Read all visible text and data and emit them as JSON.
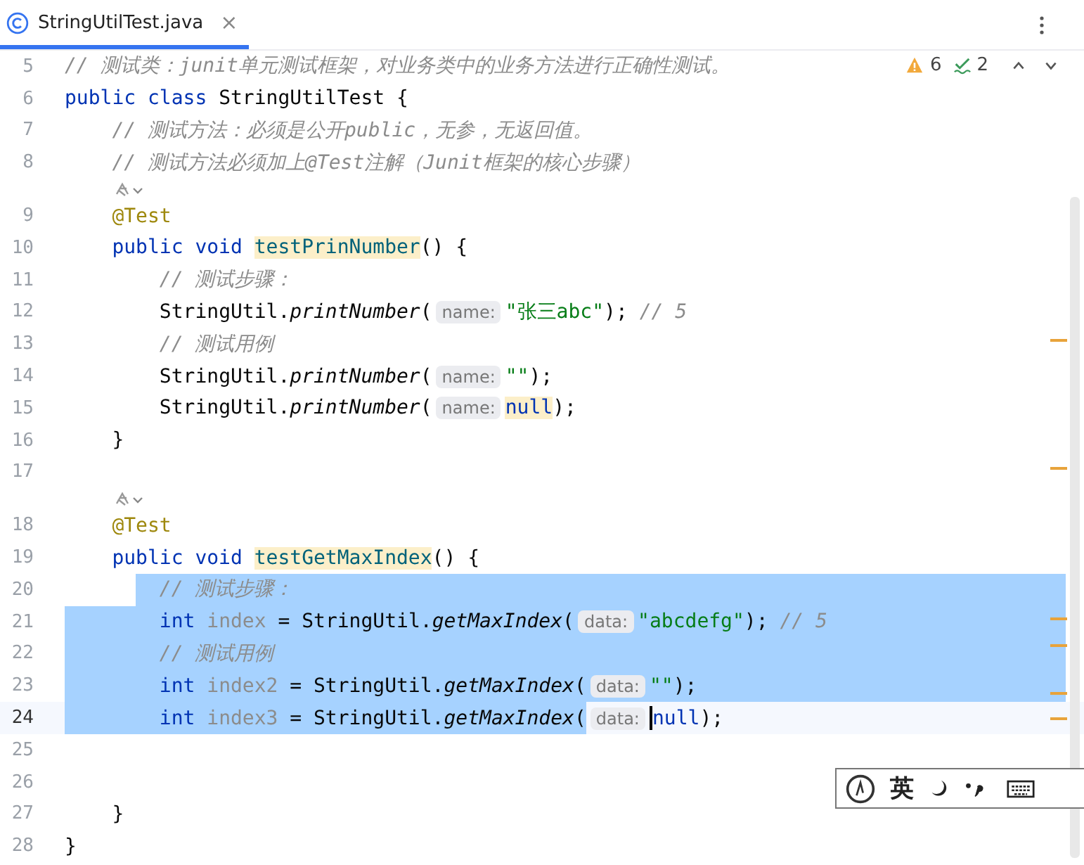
{
  "tab": {
    "title": "StringUtilTest.java",
    "selected": true,
    "close": "×"
  },
  "inspections": {
    "warnings": "6",
    "weak_warnings": "2"
  },
  "rows": [
    {
      "kind": "code",
      "number": "5",
      "selected": false,
      "current": false,
      "tokens": [
        {
          "kind": "comment",
          "text": "// 测试类：junit单元测试框架，对业务类中的业务方法进行正确性测试。"
        }
      ]
    },
    {
      "kind": "code",
      "number": "6",
      "selected": false,
      "current": false,
      "tokens": [
        {
          "kind": "keyword",
          "text": "public class "
        },
        {
          "kind": "plain",
          "text": "StringUtilTest {"
        }
      ],
      "children": [
        {
          "kind": "code",
          "number": "7",
          "selected": false,
          "current": false,
          "tokens": [
            {
              "kind": "comment",
              "text": "// 测试方法：必须是公开public，无参，无返回值。"
            }
          ]
        },
        {
          "kind": "code",
          "number": "8",
          "selected": false,
          "current": false,
          "tokens": [
            {
              "kind": "comment",
              "text": "// 测试方法必须加上@Test注解（Junit框架的核心步骤）"
            }
          ]
        },
        {
          "kind": "inlay"
        },
        {
          "kind": "code",
          "number": "9",
          "selected": false,
          "current": false,
          "tokens": [
            {
              "kind": "annotation",
              "text": "@Test"
            }
          ]
        },
        {
          "kind": "code",
          "number": "10",
          "selected": false,
          "current": false,
          "tokens": [
            {
              "kind": "keyword",
              "text": "public void "
            },
            {
              "kind": "decl",
              "text": "testPrinNumber"
            },
            {
              "kind": "plain",
              "text": "() {"
            }
          ],
          "children": [
            {
              "kind": "code",
              "number": "11",
              "selected": false,
              "current": false,
              "tokens": [
                {
                  "kind": "comment",
                  "text": "// 测试步骤："
                }
              ]
            },
            {
              "kind": "code",
              "number": "12",
              "selected": false,
              "current": false,
              "tokens": [
                {
                  "kind": "plain",
                  "text": "StringUtil."
                },
                {
                  "kind": "call",
                  "text": "printNumber"
                },
                {
                  "kind": "plain",
                  "text": "("
                },
                {
                  "kind": "hint",
                  "text": "name:"
                },
                {
                  "kind": "string",
                  "text": "\"张三abc\""
                },
                {
                  "kind": "plain",
                  "text": "); "
                },
                {
                  "kind": "comment",
                  "text": "// 5"
                }
              ]
            },
            {
              "kind": "code",
              "number": "13",
              "selected": false,
              "current": false,
              "tokens": [
                {
                  "kind": "comment",
                  "text": "// 测试用例"
                }
              ]
            },
            {
              "kind": "code",
              "number": "14",
              "selected": false,
              "current": false,
              "tokens": [
                {
                  "kind": "plain",
                  "text": "StringUtil."
                },
                {
                  "kind": "call",
                  "text": "printNumber"
                },
                {
                  "kind": "plain",
                  "text": "("
                },
                {
                  "kind": "hint",
                  "text": "name:"
                },
                {
                  "kind": "string",
                  "text": "\"\""
                },
                {
                  "kind": "plain",
                  "text": ");"
                }
              ]
            },
            {
              "kind": "code",
              "number": "15",
              "selected": false,
              "current": false,
              "tokens": [
                {
                  "kind": "plain",
                  "text": "StringUtil."
                },
                {
                  "kind": "call",
                  "text": "printNumber"
                },
                {
                  "kind": "plain",
                  "text": "("
                },
                {
                  "kind": "hint",
                  "text": "name:"
                },
                {
                  "kind": "keyword_hl",
                  "text": "null"
                },
                {
                  "kind": "plain",
                  "text": ");"
                }
              ]
            }
          ]
        },
        {
          "kind": "code",
          "number": "16",
          "selected": false,
          "current": false,
          "tokens": [
            {
              "kind": "plain",
              "text": "}"
            }
          ]
        },
        {
          "kind": "code",
          "number": "17",
          "selected": false,
          "current": false
        },
        {
          "kind": "inlay"
        },
        {
          "kind": "code",
          "number": "18",
          "selected": false,
          "current": false,
          "tokens": [
            {
              "kind": "annotation",
              "text": "@Test"
            }
          ]
        },
        {
          "kind": "code",
          "number": "19",
          "selected": false,
          "current": false,
          "tokens": [
            {
              "kind": "keyword",
              "text": "public void "
            },
            {
              "kind": "decl",
              "text": "testGetMaxIndex"
            },
            {
              "kind": "plain",
              "text": "() {"
            }
          ],
          "children": [
            {
              "kind": "code",
              "number": "20",
              "selected": true,
              "current": false,
              "tokens": [
                {
                  "kind": "comment",
                  "text": "// 测试步骤："
                }
              ]
            },
            {
              "kind": "code",
              "number": "21",
              "selected": true,
              "current": false,
              "tokens": [
                {
                  "kind": "keyword",
                  "text": "int "
                },
                {
                  "kind": "unused",
                  "text": "index"
                },
                {
                  "kind": "plain",
                  "text": " = StringUtil."
                },
                {
                  "kind": "call",
                  "text": "getMaxIndex"
                },
                {
                  "kind": "plain",
                  "text": "("
                },
                {
                  "kind": "hint",
                  "text": "data:"
                },
                {
                  "kind": "string",
                  "text": "\"abcdefg\""
                },
                {
                  "kind": "plain",
                  "text": "); "
                },
                {
                  "kind": "comment",
                  "text": "// 5"
                }
              ]
            },
            {
              "kind": "code",
              "number": "22",
              "selected": true,
              "current": false,
              "tokens": [
                {
                  "kind": "comment",
                  "text": "// 测试用例"
                }
              ]
            },
            {
              "kind": "code",
              "number": "23",
              "selected": true,
              "current": false,
              "tokens": [
                {
                  "kind": "keyword",
                  "text": "int "
                },
                {
                  "kind": "unused",
                  "text": "index2"
                },
                {
                  "kind": "plain",
                  "text": " = StringUtil."
                },
                {
                  "kind": "call",
                  "text": "getMaxIndex"
                },
                {
                  "kind": "plain",
                  "text": "("
                },
                {
                  "kind": "hint",
                  "text": "data:"
                },
                {
                  "kind": "string",
                  "text": "\"\""
                },
                {
                  "kind": "plain",
                  "text": ");"
                }
              ]
            },
            {
              "kind": "code",
              "number": "24",
              "selected": true,
              "current": true,
              "tokens": [
                {
                  "kind": "keyword",
                  "text": "int "
                },
                {
                  "kind": "unused",
                  "text": "index3"
                },
                {
                  "kind": "plain",
                  "text": " = StringUtil."
                },
                {
                  "kind": "call",
                  "text": "getMaxIndex"
                },
                {
                  "kind": "plain",
                  "text": "("
                },
                {
                  "kind": "hint",
                  "text": "data:"
                },
                {
                  "kind": "caret"
                },
                {
                  "kind": "keyword",
                  "text": "null"
                },
                {
                  "kind": "plain",
                  "text": ");"
                }
              ]
            },
            {
              "kind": "code",
              "number": "25",
              "selected": false,
              "current": false
            },
            {
              "kind": "code",
              "number": "26",
              "selected": false,
              "current": false
            }
          ]
        },
        {
          "kind": "code",
          "number": "27",
          "selected": false,
          "current": false,
          "tokens": [
            {
              "kind": "plain",
              "text": "}"
            }
          ]
        }
      ]
    },
    {
      "kind": "code",
      "number": "28",
      "selected": false,
      "current": false,
      "tokens": [
        {
          "kind": "plain",
          "text": "}"
        }
      ]
    }
  ],
  "ime_toolbar": {
    "label": "英"
  }
}
